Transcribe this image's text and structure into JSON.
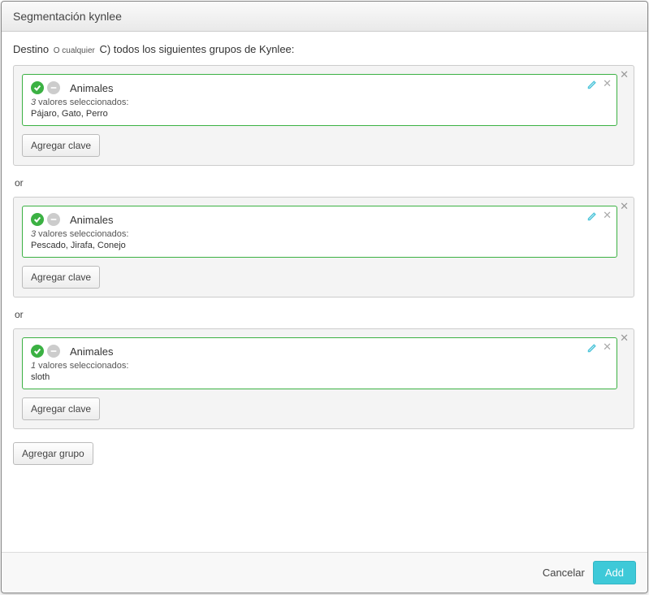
{
  "header": {
    "title": "Segmentación kynlee"
  },
  "intro": {
    "destino": "Destino",
    "option_any": "O cualquier",
    "suffix": "C) todos los siguientes grupos de Kynlee:"
  },
  "groups": [
    {
      "key": {
        "title": "Animales",
        "count": "3",
        "selected_label": " valores seleccionados:",
        "values": "Pájaro, Gato, Perro"
      },
      "add_key_label": "Agregar clave"
    },
    {
      "key": {
        "title": "Animales",
        "count": "3",
        "selected_label": " valores seleccionados:",
        "values": "Pescado, Jirafa, Conejo"
      },
      "add_key_label": "Agregar clave"
    },
    {
      "key": {
        "title": "Animales",
        "count": "1",
        "selected_label": " valores seleccionados:",
        "values": "sloth"
      },
      "add_key_label": "Agregar clave"
    }
  ],
  "or_label": "or",
  "add_group_label": "Agregar grupo",
  "footer": {
    "cancel": "Cancelar",
    "add": "Add"
  }
}
